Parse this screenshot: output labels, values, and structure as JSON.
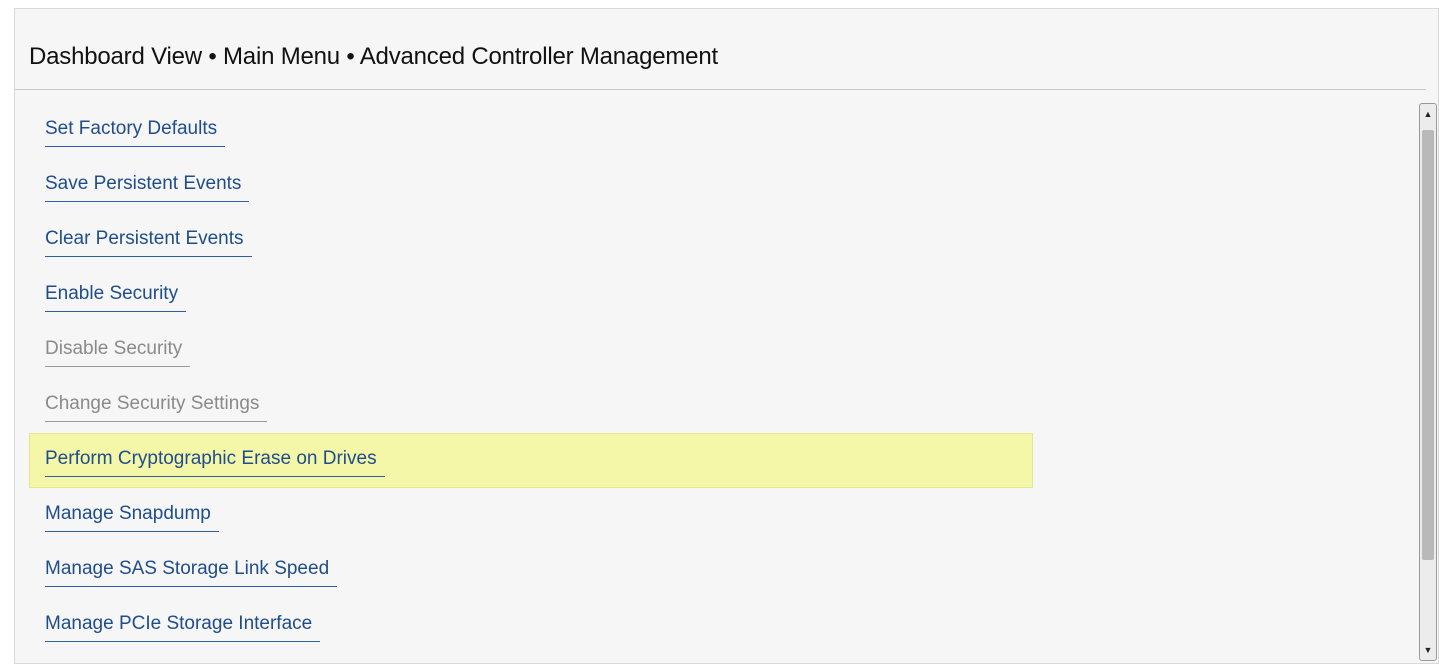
{
  "header": {
    "breadcrumb": "Dashboard View • Main Menu • Advanced Controller Management"
  },
  "menu": {
    "items": [
      {
        "label": "Set Factory Defaults",
        "state": "enabled"
      },
      {
        "label": "Save Persistent Events",
        "state": "enabled"
      },
      {
        "label": "Clear Persistent Events",
        "state": "enabled"
      },
      {
        "label": "Enable Security",
        "state": "enabled"
      },
      {
        "label": "Disable Security",
        "state": "disabled"
      },
      {
        "label": "Change Security Settings",
        "state": "disabled"
      },
      {
        "label": "Perform Cryptographic Erase on Drives",
        "state": "selected"
      },
      {
        "label": "Manage Snapdump",
        "state": "enabled"
      },
      {
        "label": "Manage SAS Storage Link Speed",
        "state": "enabled"
      },
      {
        "label": "Manage PCIe Storage Interface",
        "state": "enabled"
      }
    ]
  },
  "scrollbar": {
    "up_icon": "scroll-up-arrow",
    "down_icon": "scroll-down-arrow"
  },
  "colors": {
    "link": "#1f4d8c",
    "disabled": "#8a8a8a",
    "highlight": "#f4f7a8",
    "background": "#f6f6f6"
  }
}
